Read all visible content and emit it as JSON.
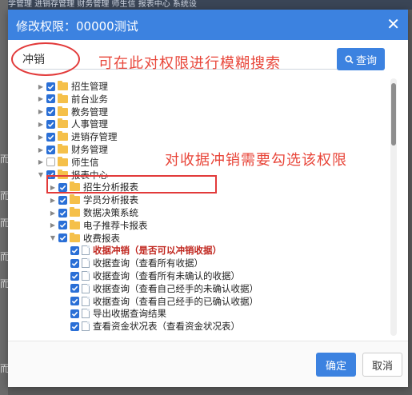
{
  "background": {
    "topbar_text": "入学管理      进销存管理      财务管理      师生信      报表中心      系统设",
    "left_glimpses": [
      "而",
      "而",
      "而",
      "而",
      "而",
      "而"
    ]
  },
  "dialog": {
    "title": "修改权限：00000测试",
    "search": {
      "value": "冲销",
      "button_label": "查询"
    },
    "annotations": {
      "search_hint": "可在此对权限进行模糊搜索",
      "tree_hint": "对收据冲销需要勾选该权限"
    },
    "footer": {
      "ok_label": "确定",
      "cancel_label": "取消"
    }
  },
  "tree": [
    {
      "label": "招生管理",
      "depth": 0,
      "arrow": "collapsed",
      "checked": true,
      "icon": "folder"
    },
    {
      "label": "前台业务",
      "depth": 0,
      "arrow": "collapsed",
      "checked": true,
      "icon": "folder"
    },
    {
      "label": "教务管理",
      "depth": 0,
      "arrow": "collapsed",
      "checked": true,
      "icon": "folder"
    },
    {
      "label": "人事管理",
      "depth": 0,
      "arrow": "collapsed",
      "checked": true,
      "icon": "folder"
    },
    {
      "label": "进销存管理",
      "depth": 0,
      "arrow": "collapsed",
      "checked": true,
      "icon": "folder"
    },
    {
      "label": "财务管理",
      "depth": 0,
      "arrow": "collapsed",
      "checked": true,
      "icon": "folder"
    },
    {
      "label": "师生信",
      "depth": 0,
      "arrow": "collapsed",
      "checked": false,
      "icon": "folder"
    },
    {
      "label": "报表中心",
      "depth": 0,
      "arrow": "expanded",
      "checked": true,
      "icon": "folder"
    },
    {
      "label": "招生分析报表",
      "depth": 1,
      "arrow": "collapsed",
      "checked": true,
      "icon": "folder"
    },
    {
      "label": "学员分析报表",
      "depth": 1,
      "arrow": "collapsed",
      "checked": true,
      "icon": "folder"
    },
    {
      "label": "数据决策系统",
      "depth": 1,
      "arrow": "collapsed",
      "checked": true,
      "icon": "folder"
    },
    {
      "label": "电子推荐卡报表",
      "depth": 1,
      "arrow": "collapsed",
      "checked": true,
      "icon": "folder"
    },
    {
      "label": "收费报表",
      "depth": 1,
      "arrow": "expanded",
      "checked": true,
      "icon": "folder"
    },
    {
      "label": "收据冲销（是否可以冲销收据）",
      "depth": 2,
      "arrow": "none",
      "checked": true,
      "icon": "file",
      "highlight": true
    },
    {
      "label": "收据查询（查看所有收据）",
      "depth": 2,
      "arrow": "none",
      "checked": true,
      "icon": "file"
    },
    {
      "label": "收据查询（查看所有未确认的收据）",
      "depth": 2,
      "arrow": "none",
      "checked": true,
      "icon": "file"
    },
    {
      "label": "收据查询（查看自己经手的未确认收据）",
      "depth": 2,
      "arrow": "none",
      "checked": true,
      "icon": "file"
    },
    {
      "label": "收据查询（查看自己经手的已确认收据）",
      "depth": 2,
      "arrow": "none",
      "checked": true,
      "icon": "file"
    },
    {
      "label": "导出收据查询结果",
      "depth": 2,
      "arrow": "none",
      "checked": true,
      "icon": "file"
    },
    {
      "label": "查看资金状况表（查看资金状况表）",
      "depth": 2,
      "arrow": "none",
      "checked": true,
      "icon": "file"
    }
  ],
  "icons": {
    "close": "close-icon",
    "search": "search-icon",
    "folder": "folder-icon",
    "file": "file-icon",
    "collapsed_arrow": "caret-right-icon",
    "expanded_arrow": "caret-down-icon"
  },
  "colors": {
    "primary": "#3c82e0",
    "checkbox": "#2a6fd6",
    "annotation": "#e8463a",
    "highlight_text": "#c0261e",
    "folder": "#f5c04a"
  }
}
